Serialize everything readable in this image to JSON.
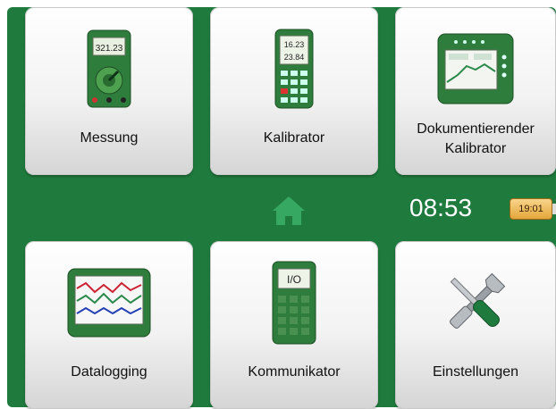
{
  "tiles": {
    "measure": {
      "label": "Messung",
      "icon": "multimeter-icon",
      "display": "321.23"
    },
    "calibrator": {
      "label": "Kalibrator",
      "icon": "calibrator-icon",
      "display_top": "16.23",
      "display_bottom": "23.84"
    },
    "doc_calibrator": {
      "label_line1": "Dokumentierender",
      "label_line2": "Kalibrator",
      "icon": "documenting-calibrator-icon"
    },
    "datalogging": {
      "label": "Datalogging",
      "icon": "datalogger-icon"
    },
    "communicator": {
      "label": "Kommunikator",
      "icon": "communicator-icon",
      "display": "I/O"
    },
    "settings": {
      "label": "Einstellungen",
      "icon": "wrench-screwdriver-icon"
    }
  },
  "status_bar": {
    "home_icon": "home-icon",
    "clock": "08:53",
    "battery": "19:01"
  },
  "colors": {
    "brand_green": "#1e7a3d",
    "home_icon": "#36a862",
    "battery": "#e8ae45"
  }
}
